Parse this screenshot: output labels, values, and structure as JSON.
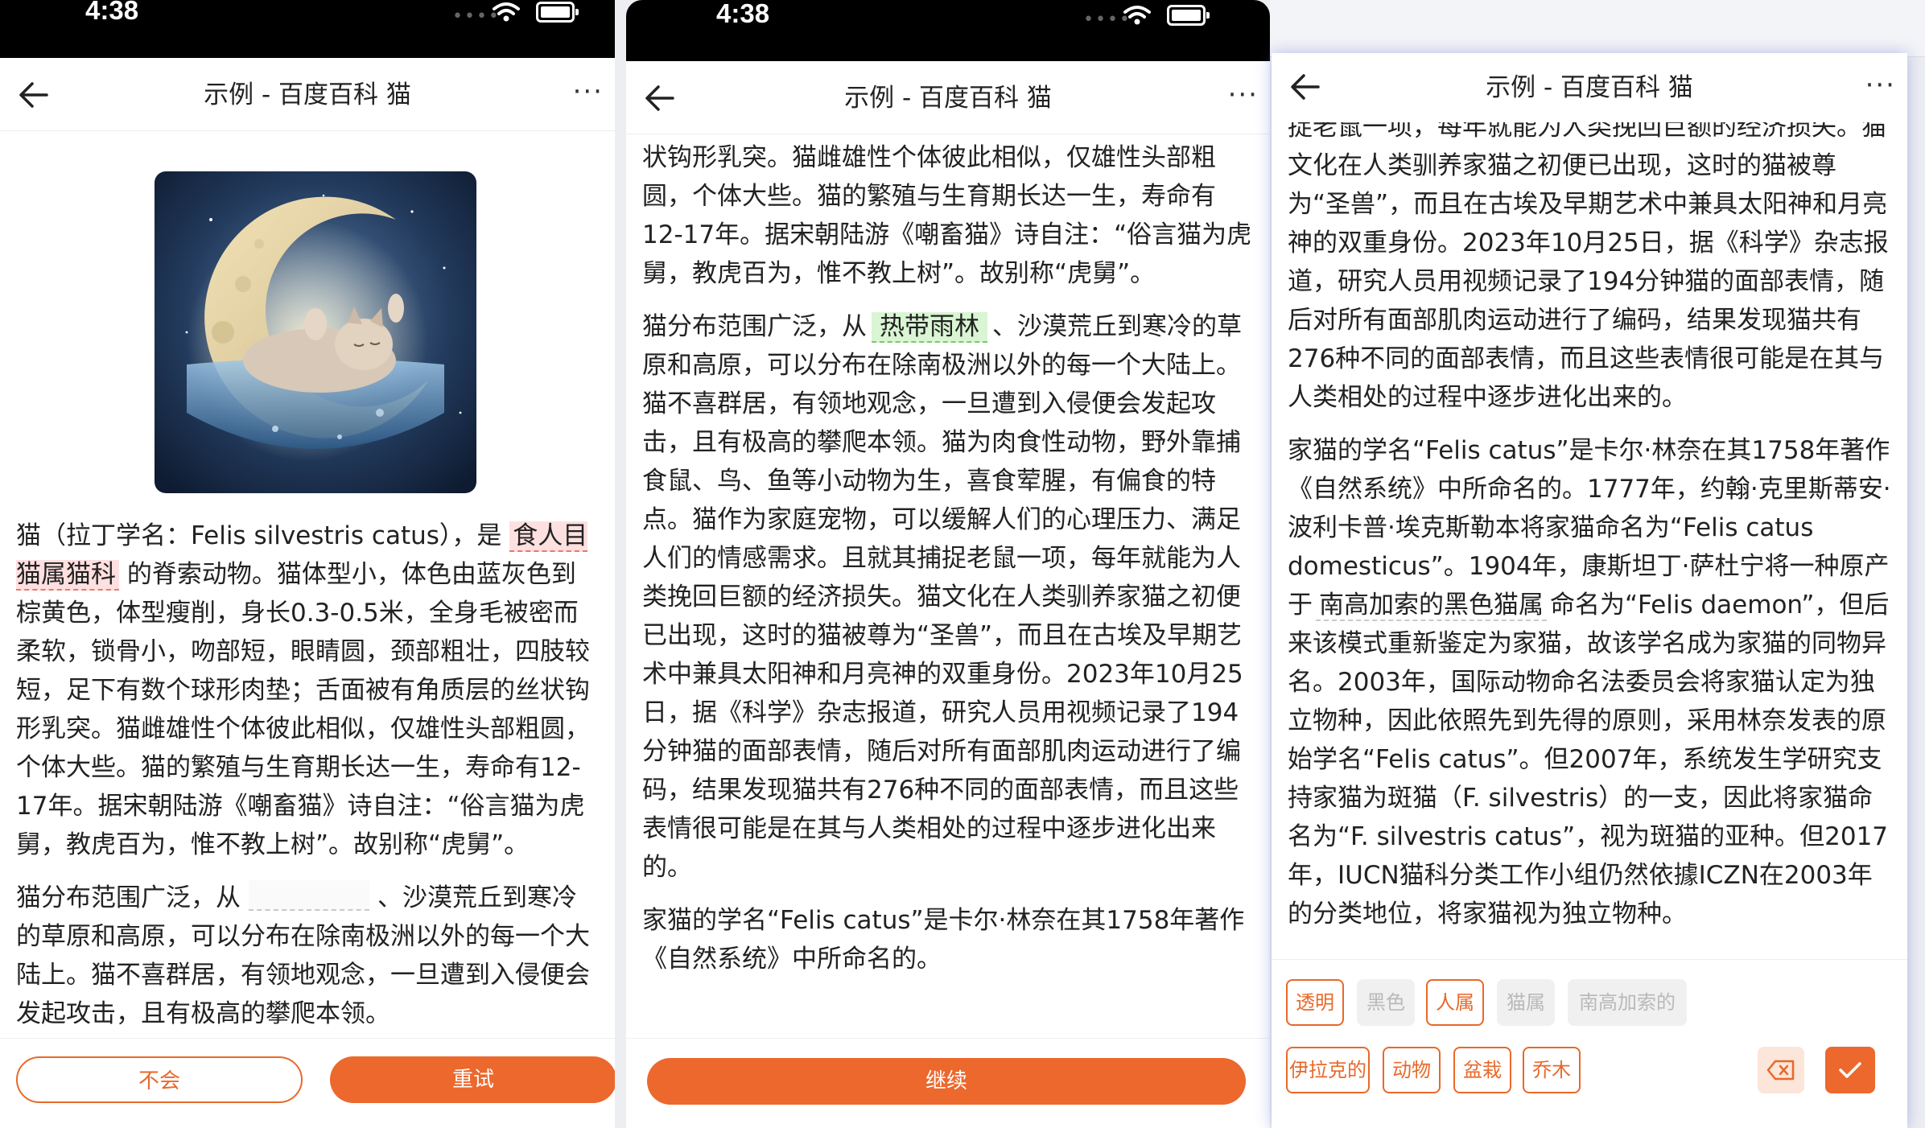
{
  "status_time": "4:38",
  "nav_title": "示例 - 百度百科 猫",
  "more_label": "···",
  "screen1": {
    "paragraphs": [
      {
        "before": "猫（拉丁学名：Felis silvestris catus），是",
        "highlight": "食人目猫属猫科",
        "after": "的脊索动物。猫体型小，体色由蓝灰色到棕黄色，体型瘦削，身长0.3-0.5米，全身毛被密而柔软，锁骨小，吻部短，眼睛圆，颈部粗壮，四肢较短，足下有数个球形肉垫；舌面被有角质层的丝状钩形乳突。猫雌雄性个体彼此相似，仅雄性头部粗圆，个体大些。猫的繁殖与生育期长达一生，寿命有12-17年。据宋朝陆游《嘲畜猫》诗自注：“俗言猫为虎舅，教虎百为，惟不教上树”。故别称“虎舅”。"
      },
      {
        "before": "猫分布范围广泛，从",
        "after": "、沙漠荒丘到寒冷的草原和高原，可以分布在除南极洲以外的每一个大陆上。猫不喜群居，有领地观念，一旦遭到入侵便会发起攻击，且有极高的攀爬本领。"
      }
    ],
    "btn_dont_know": "不会",
    "btn_retry": "重试"
  },
  "screen2": {
    "p1": "状钩形乳突。猫雌雄性个体彼此相似，仅雄性头部粗圆，个体大些。猫的繁殖与生育期长达一生，寿命有12-17年。据宋朝陆游《嘲畜猫》诗自注：“俗言猫为虎舅，教虎百为，惟不教上树”。故别称“虎舅”。",
    "p2_before": "猫分布范围广泛，从",
    "p2_highlight": "热带雨林",
    "p2_after": "、沙漠荒丘到寒冷的草原和高原，可以分布在除南极洲以外的每一个大陆上。猫不喜群居，有领地观念，一旦遭到入侵便会发起攻击，且有极高的攀爬本领。猫为肉食性动物，野外靠捕食鼠、鸟、鱼等小动物为生，喜食荤腥，有偏食的特点。猫作为家庭宠物，可以缓解人们的心理压力、满足人们的情感需求。且就其捕捉老鼠一项，每年就能为人类挽回巨额的经济损失。猫文化在人类驯养家猫之初便已出现，这时的猫被尊为“圣兽”，而且在古埃及早期艺术中兼具太阳神和月亮神的双重身份。2023年10月25日，据《科学》杂志报道，研究人员用视频记录了194分钟猫的面部表情，随后对所有面部肌肉运动进行了编码，结果发现猫共有276种不同的面部表情，而且这些表情很可能是在其与人类相处的过程中逐步进化出来的。",
    "p3": "家猫的学名“Felis catus”是卡尔·林奈在其1758年著作《自然系统》中所命名的。",
    "btn_continue": "继续"
  },
  "screen3": {
    "p1": "捉老鼠一项，每年就能为人类挽回巨额的经济损失。猫文化在人类驯养家猫之初便已出现，这时的猫被尊为“圣兽”，而且在古埃及早期艺术中兼具太阳神和月亮神的双重身份。2023年10月25日，据《科学》杂志报道，研究人员用视频记录了194分钟猫的面部表情，随后对所有面部肌肉运动进行了编码，结果发现猫共有276种不同的面部表情，而且这些表情很可能是在其与人类相处的过程中逐步进化出来的。",
    "p2_before": "家猫的学名“Felis catus”是卡尔·林奈在其1758年著作《自然系统》中所命名的。1777年，约翰·克里斯蒂安·波利卡普·埃克斯勒本将家猫命名为“Felis catus domesticus”。1904年，康斯坦丁·萨杜宁将一种原产于",
    "p2_highlight": "南高加索的黑色猫属",
    "p2_after": "命名为“Felis daemon”，但后来该模式重新鉴定为家猫，故该学名成为家猫的同物异名。2003年，国际动物命名法委员会将家猫认定为独立物种，因此依照先到先得的原则，采用林奈发表的原始学名“Felis catus”。但2007年，系统发生学研究支持家猫为斑猫（F. silvestris）的一支，因此将家猫命名为“F. silvestris catus”，视为斑猫的亚种。但2017年，IUCN猫科分类工作小组仍然依據ICZN在2003年的分类地位，将家猫视为独立物种。",
    "chips_row1": [
      {
        "label": "透明",
        "state": "active"
      },
      {
        "label": "黑色",
        "state": "disabled"
      },
      {
        "label": "人属",
        "state": "active"
      },
      {
        "label": "猫属",
        "state": "disabled"
      },
      {
        "label": "南高加索的",
        "state": "disabled"
      }
    ],
    "chips_row2": [
      {
        "label": "伊拉克的",
        "state": "active"
      },
      {
        "label": "动物",
        "state": "active"
      },
      {
        "label": "盆栽",
        "state": "active"
      },
      {
        "label": "乔木",
        "state": "active"
      }
    ]
  },
  "colors": {
    "accent": "#ec682d",
    "highlight_red": "#fde0df",
    "highlight_green": "#d9f5d3"
  }
}
